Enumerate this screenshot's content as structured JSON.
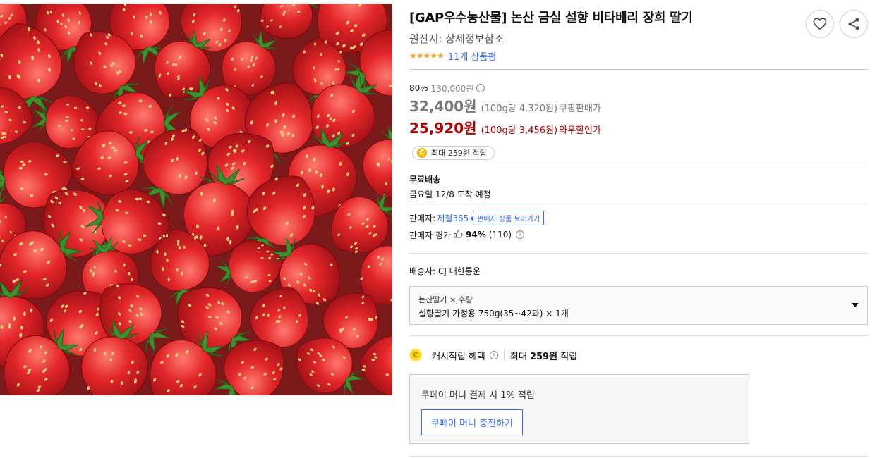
{
  "product": {
    "title": "[GAP우수농산물] 논산 금실 설향 비타베리 장희 딸기",
    "origin": "원산지: 상세정보참조",
    "stars": "★★★★★",
    "review_count": "11개 상품평"
  },
  "icons": {
    "wishlist": "heart-icon",
    "share": "share-icon"
  },
  "price": {
    "discount_rate": "80%",
    "original_price": "130,000원",
    "info_icon": "ⓘ",
    "sale_price": "32,400원",
    "sale_unit": "(100g당 4,320원)",
    "sale_label": "쿠팡판매가",
    "wow_price": "25,920원",
    "wow_unit": "(100g당 3,456원)",
    "wow_label": "와우할인가",
    "cash_chip": "최대 259원 적립",
    "coin_letter": "C"
  },
  "shipping": {
    "title": "무료배송",
    "arrival": "금요일 12/8 도착 예정"
  },
  "seller": {
    "label": "판매자:",
    "name": "제철365",
    "tooltip": "판매자 상품 보러가기",
    "rating_label": "판매자 평가",
    "rating_percent": "94%",
    "rating_count": "(110)"
  },
  "carrier": "배송사: CJ 대한통운",
  "option": {
    "label": "논산딸기 × 수량",
    "value": "설향딸기 가정용 750g(35~42과) × 1개"
  },
  "benefit": {
    "label": "캐시적립 혜택",
    "value_prefix": "최대 ",
    "value_amount": "259원",
    "value_suffix": " 적립"
  },
  "coupay": {
    "text": "쿠페이 머니 결제 시 1% 적립",
    "button": "쿠페이 머니 충전하기"
  },
  "colors": {
    "accent_blue": "#346aff",
    "wow_red": "#ae0000",
    "star_orange": "#f7a11d",
    "coin_yellow": "#ffd400"
  }
}
